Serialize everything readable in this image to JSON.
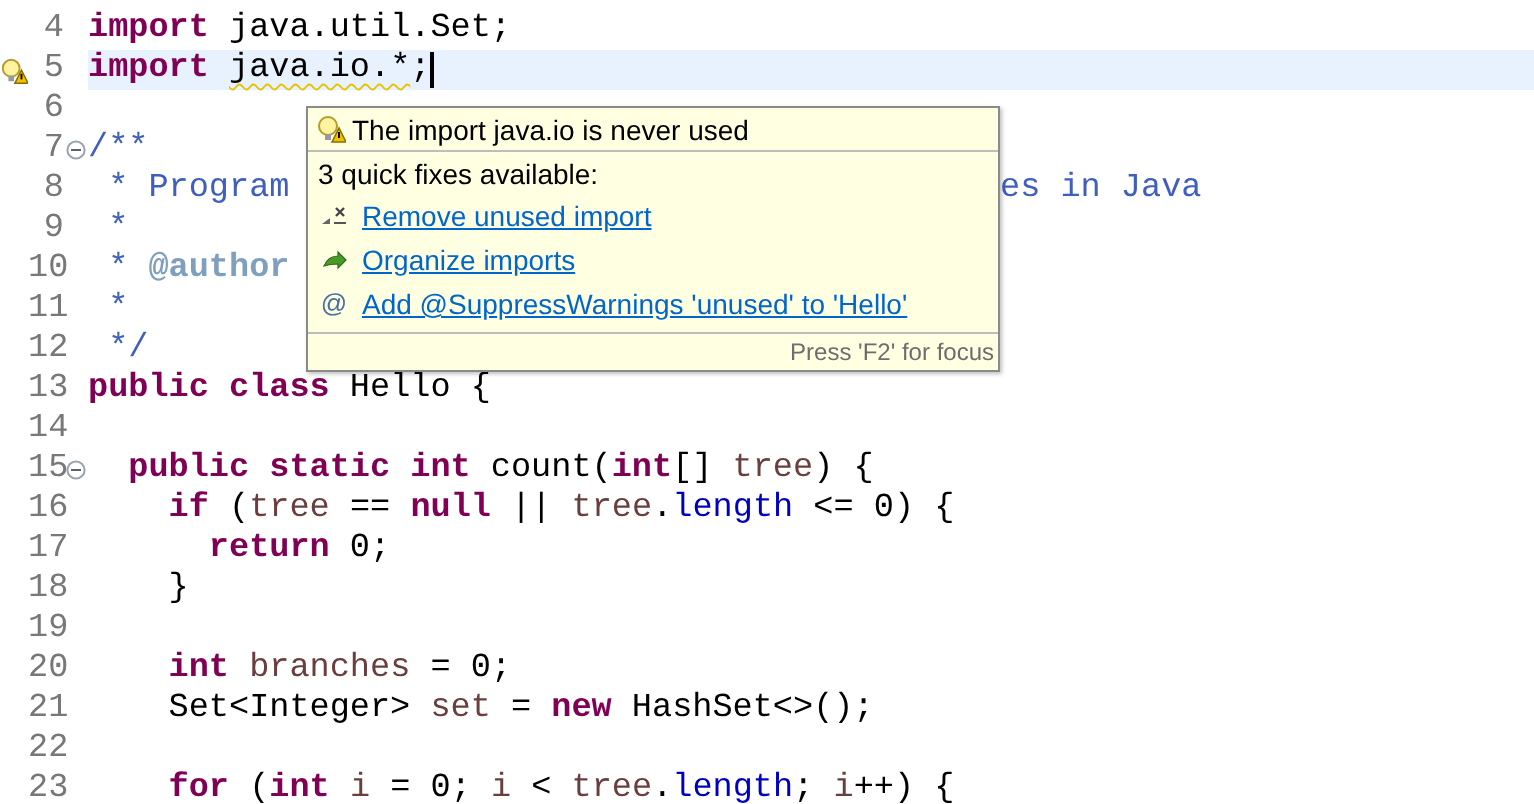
{
  "editor": {
    "lines": [
      {
        "number": "4",
        "current": false,
        "warning": false,
        "foldable": false,
        "tokens": [
          {
            "text": "import ",
            "kind": "keyword"
          },
          {
            "text": "java.util.Set;",
            "kind": "plain"
          }
        ]
      },
      {
        "number": "5",
        "current": true,
        "warning": true,
        "foldable": false,
        "tokens": [
          {
            "text": "import ",
            "kind": "keyword"
          },
          {
            "text": "java.io.*",
            "kind": "plain",
            "squiggle": true
          },
          {
            "text": ";",
            "kind": "plain"
          }
        ]
      },
      {
        "number": "6",
        "current": false,
        "warning": false,
        "foldable": false
      },
      {
        "number": "7",
        "current": false,
        "warning": false,
        "foldable": true,
        "tokens": [
          {
            "text": "/**",
            "kind": "comment"
          }
        ]
      },
      {
        "number": "8",
        "current": false,
        "warning": false,
        "foldable": false,
        "tokens": [
          {
            "text": " * Program",
            "kind": "comment"
          },
          {
            "text": "es in Java",
            "kind": "comment",
            "after_popup": true
          }
        ]
      },
      {
        "number": "9",
        "current": false,
        "warning": false,
        "foldable": false,
        "tokens": [
          {
            "text": " *",
            "kind": "comment"
          }
        ]
      },
      {
        "number": "10",
        "current": false,
        "warning": false,
        "foldable": false,
        "tokens": [
          {
            "text": " * ",
            "kind": "comment"
          },
          {
            "text": "@author",
            "kind": "doctag"
          }
        ]
      },
      {
        "number": "11",
        "current": false,
        "warning": false,
        "foldable": false,
        "tokens": [
          {
            "text": " *",
            "kind": "comment"
          }
        ]
      },
      {
        "number": "12",
        "current": false,
        "warning": false,
        "foldable": false,
        "tokens": [
          {
            "text": " */",
            "kind": "comment"
          }
        ]
      },
      {
        "number": "13",
        "current": false,
        "warning": false,
        "foldable": false,
        "tokens": [
          {
            "text": "public class",
            "kind": "keyword"
          },
          {
            "text": " Hello {",
            "kind": "plain"
          }
        ]
      },
      {
        "number": "14",
        "current": false,
        "warning": false,
        "foldable": false
      },
      {
        "number": "15",
        "current": false,
        "warning": false,
        "foldable": true,
        "tokens": [
          {
            "text": "  public static int",
            "kind": "keyword"
          },
          {
            "text": " count(",
            "kind": "plain"
          },
          {
            "text": "int",
            "kind": "keyword"
          },
          {
            "text": "[] ",
            "kind": "plain"
          },
          {
            "text": "tree",
            "kind": "local"
          },
          {
            "text": ") {",
            "kind": "plain"
          }
        ]
      },
      {
        "number": "16",
        "current": false,
        "warning": false,
        "foldable": false,
        "tokens": [
          {
            "text": "    if",
            "kind": "keyword"
          },
          {
            "text": " (",
            "kind": "plain"
          },
          {
            "text": "tree",
            "kind": "local"
          },
          {
            "text": " == ",
            "kind": "plain"
          },
          {
            "text": "null",
            "kind": "keyword"
          },
          {
            "text": " || ",
            "kind": "plain"
          },
          {
            "text": "tree",
            "kind": "local"
          },
          {
            "text": ".",
            "kind": "plain"
          },
          {
            "text": "length",
            "kind": "field"
          },
          {
            "text": " <= 0) {",
            "kind": "plain"
          }
        ]
      },
      {
        "number": "17",
        "current": false,
        "warning": false,
        "foldable": false,
        "tokens": [
          {
            "text": "      return",
            "kind": "keyword"
          },
          {
            "text": " 0;",
            "kind": "plain"
          }
        ]
      },
      {
        "number": "18",
        "current": false,
        "warning": false,
        "foldable": false,
        "tokens": [
          {
            "text": "    }",
            "kind": "plain"
          }
        ]
      },
      {
        "number": "19",
        "current": false,
        "warning": false,
        "foldable": false
      },
      {
        "number": "20",
        "current": false,
        "warning": false,
        "foldable": false,
        "tokens": [
          {
            "text": "    int ",
            "kind": "keyword"
          },
          {
            "text": "branches",
            "kind": "local"
          },
          {
            "text": " = 0;",
            "kind": "plain"
          }
        ]
      },
      {
        "number": "21",
        "current": false,
        "warning": false,
        "foldable": false,
        "tokens": [
          {
            "text": "    Set<Integer> ",
            "kind": "plain"
          },
          {
            "text": "set",
            "kind": "local"
          },
          {
            "text": " = ",
            "kind": "plain"
          },
          {
            "text": "new",
            "kind": "keyword"
          },
          {
            "text": " HashSet<>();",
            "kind": "plain"
          }
        ]
      },
      {
        "number": "22",
        "current": false,
        "warning": false,
        "foldable": false
      },
      {
        "number": "23",
        "current": false,
        "warning": false,
        "foldable": false,
        "tokens": [
          {
            "text": "    for",
            "kind": "keyword"
          },
          {
            "text": " (",
            "kind": "plain"
          },
          {
            "text": "int ",
            "kind": "keyword"
          },
          {
            "text": "i",
            "kind": "local"
          },
          {
            "text": " = 0; ",
            "kind": "plain"
          },
          {
            "text": "i",
            "kind": "local"
          },
          {
            "text": " < ",
            "kind": "plain"
          },
          {
            "text": "tree",
            "kind": "local"
          },
          {
            "text": ".",
            "kind": "plain"
          },
          {
            "text": "length",
            "kind": "field"
          },
          {
            "text": "; ",
            "kind": "plain"
          },
          {
            "text": "i",
            "kind": "local"
          },
          {
            "text": "++) {",
            "kind": "plain"
          }
        ]
      }
    ]
  },
  "hover": {
    "title": "The import java.io is never used",
    "subtitle": "3 quick fixes available:",
    "fixes": [
      {
        "label": "Remove unused import",
        "kind": "remove"
      },
      {
        "label": "Organize imports",
        "kind": "organize"
      },
      {
        "label": "Add @SuppressWarnings 'unused' to 'Hello'",
        "kind": "annotation",
        "icon": "@"
      }
    ],
    "footer": "Press 'F2' for focus"
  }
}
